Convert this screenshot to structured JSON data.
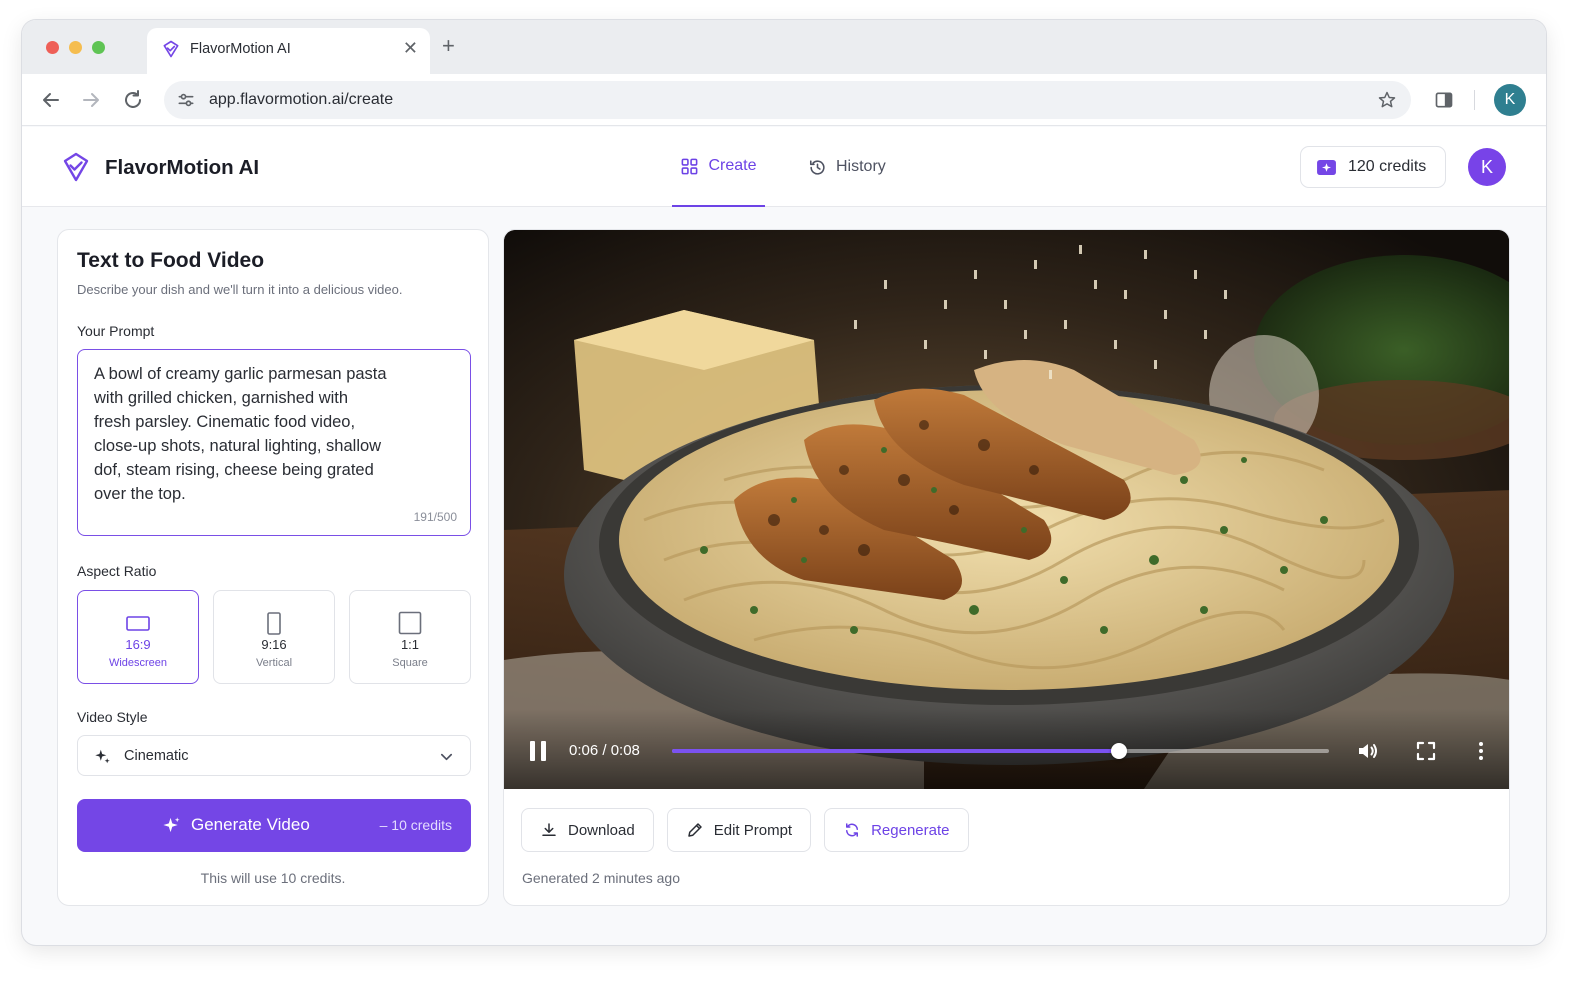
{
  "browser": {
    "tab_title": "FlavorMotion AI",
    "tab_close": "✕",
    "new_tab": "+",
    "url": "app.flavormotion.ai/create",
    "profile_initial": "K"
  },
  "header": {
    "brand": "FlavorMotion AI",
    "nav": [
      {
        "label": "Create",
        "active": true
      },
      {
        "label": "History",
        "active": false
      }
    ],
    "credits": "120 credits",
    "avatar_initial": "K",
    "accent_color": "#6d43e6"
  },
  "form": {
    "title": "Text to Food Video",
    "subtitle": "Describe your dish and we'll turn it into a delicious video.",
    "prompt_label": "Your Prompt",
    "prompt_value": "A bowl of creamy garlic parmesan pasta\nwith grilled chicken, garnished with\nfresh parsley. Cinematic food video,\nclose-up shots, natural lighting, shallow\ndof, steam rising, cheese being grated\nover the top.",
    "prompt_count": "191/500",
    "aspect_label": "Aspect Ratio",
    "aspect_options": [
      {
        "ratio": "16:9",
        "name": "Widescreen",
        "selected": true
      },
      {
        "ratio": "9:16",
        "name": "Vertical",
        "selected": false
      },
      {
        "ratio": "1:1",
        "name": "Square",
        "selected": false
      }
    ],
    "style_label": "Video Style",
    "style_value": "Cinematic",
    "generate_label": "Generate Video",
    "generate_cost": "– 10 credits",
    "generate_note": "This will use 10 credits."
  },
  "player": {
    "time": "0:06 / 0:08",
    "progress": 0.68
  },
  "actions": {
    "download": "Download",
    "edit": "Edit Prompt",
    "regenerate": "Regenerate"
  },
  "generated_info": "Generated 2 minutes ago"
}
